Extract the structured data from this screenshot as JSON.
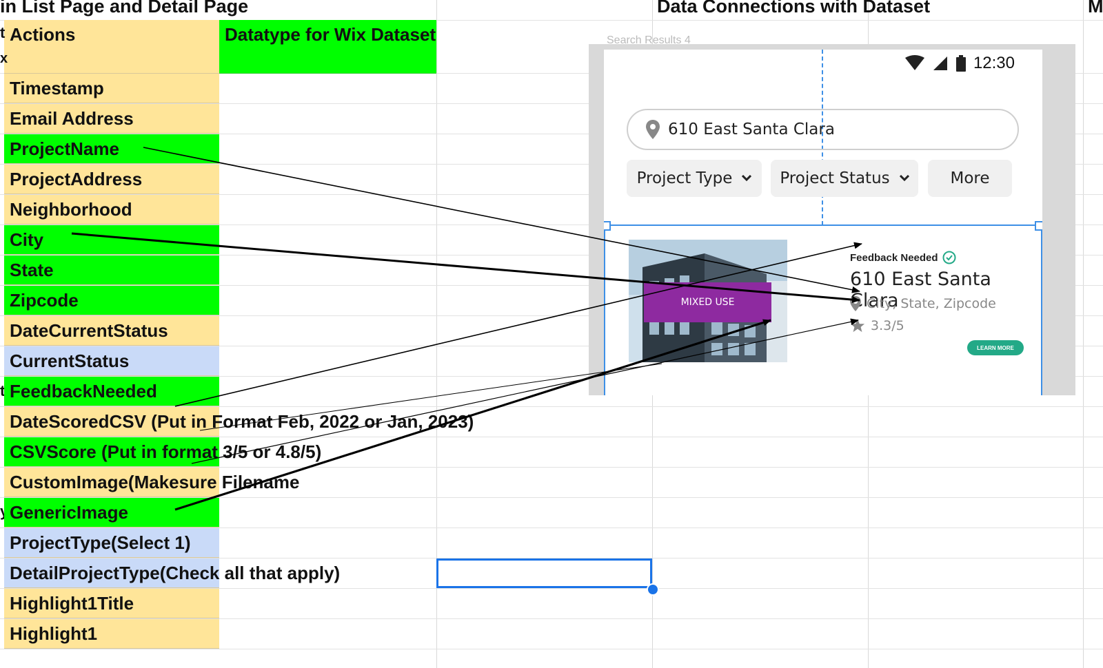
{
  "headers": {
    "left": "in List Page and Detail Page",
    "middle": "Data Connections with Dataset",
    "right": "M"
  },
  "columns": {
    "actions": "Actions",
    "datatype": "Datatype for Wix Dataset"
  },
  "row_fragments": [
    "t",
    "x",
    "t",
    "y"
  ],
  "rows": [
    {
      "label": "Timestamp",
      "color": "#ffe599"
    },
    {
      "label": "Email Address",
      "color": "#ffe599"
    },
    {
      "label": "ProjectName",
      "color": "#00ff00"
    },
    {
      "label": "ProjectAddress",
      "color": "#ffe599"
    },
    {
      "label": "Neighborhood",
      "color": "#ffe599"
    },
    {
      "label": "City",
      "color": "#00ff00"
    },
    {
      "label": "State",
      "color": "#00ff00"
    },
    {
      "label": "Zipcode",
      "color": "#00ff00"
    },
    {
      "label": "DateCurrentStatus",
      "color": "#ffe599"
    },
    {
      "label": "CurrentStatus",
      "color": "#c9daf8"
    },
    {
      "label": "FeedbackNeeded",
      "color": "#00ff00"
    },
    {
      "label": "DateScoredCSV (Put in Format  Feb, 2022 or Jan, 2023)",
      "color": "#ffe599"
    },
    {
      "label": "CSVScore (Put in format 3/5 or 4.8/5)",
      "color": "#00ff00"
    },
    {
      "label": "CustomImage(Makesure Filename",
      "color": "#ffe599"
    },
    {
      "label": "GenericImage",
      "color": "#00ff00"
    },
    {
      "label": "ProjectType(Select 1)",
      "color": "#c9daf8"
    },
    {
      "label": "DetailProjectType(Check all that apply)",
      "color": "#c9daf8"
    },
    {
      "label": "Highlight1Title",
      "color": "#ffe599"
    },
    {
      "label": "Highlight1",
      "color": "#ffe599"
    }
  ],
  "mock": {
    "ghost_text": "Search Results 4",
    "time": "12:30",
    "search_value": "610 East Santa Clara",
    "chips": [
      "Project Type",
      "Project Status",
      "More"
    ],
    "card": {
      "badge": "MIXED USE",
      "feedback": "Feedback Needed",
      "address": "610 East Santa Clara",
      "location": "City, State, Zipcode",
      "rating": "3.3/5",
      "button": "LEARN MORE"
    }
  },
  "colors": {
    "tan": "#ffe599",
    "green": "#00ff00",
    "blue": "#c9daf8",
    "selection": "#1a73e8",
    "badge": "#8e2aa0",
    "learn_more": "#23a987"
  }
}
